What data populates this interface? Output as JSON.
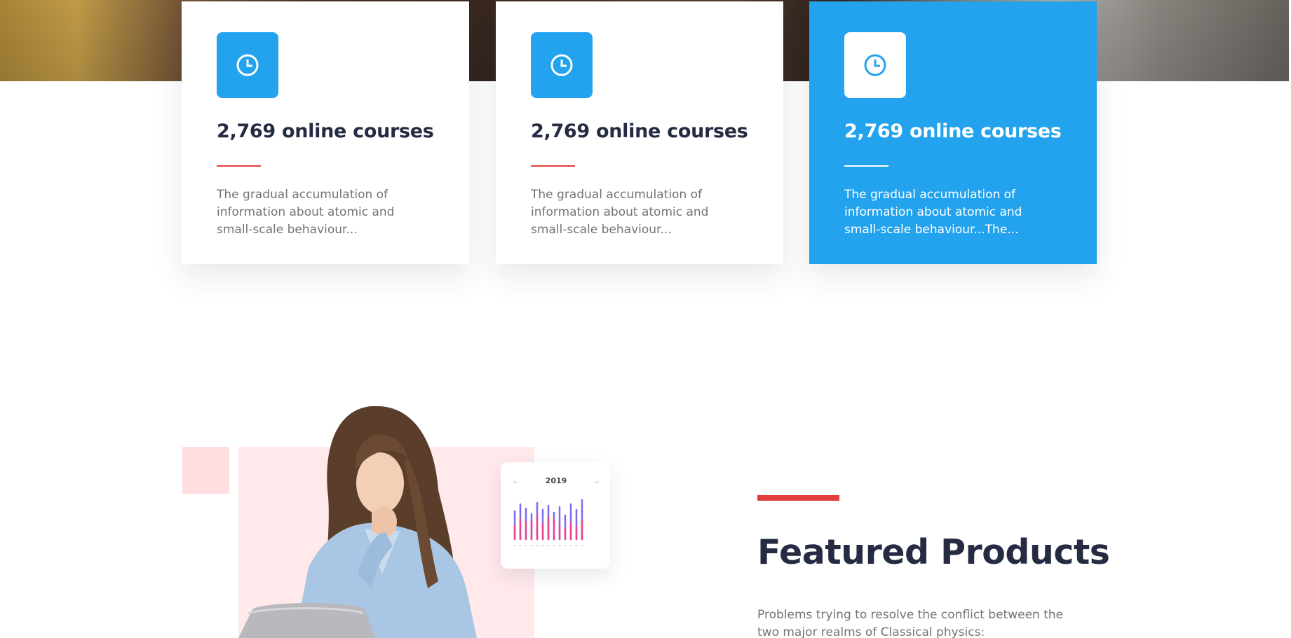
{
  "cards": [
    {
      "icon": "clock-icon",
      "title": "2,769 online courses",
      "text": "The gradual accumulation of information about atomic and small-scale behaviour..."
    },
    {
      "icon": "clock-icon",
      "title": "2,769 online courses",
      "text": "The gradual accumulation of information about atomic and small-scale behaviour..."
    },
    {
      "icon": "clock-icon",
      "title": "2,769 online courses",
      "text": "The gradual accumulation of information about atomic and small-scale behaviour...The..."
    }
  ],
  "stats_card": {
    "prev_arrow": "←",
    "year": "2019",
    "next_arrow": "→"
  },
  "featured": {
    "title": "Featured Products",
    "text": "Problems trying to resolve the conflict between the two major realms of Classical physics:"
  },
  "colors": {
    "accent_blue": "#23a3ed",
    "accent_red": "#e23c3c",
    "heading": "#252b42",
    "body_text": "#737373",
    "pink_light": "#ffe9eb"
  }
}
